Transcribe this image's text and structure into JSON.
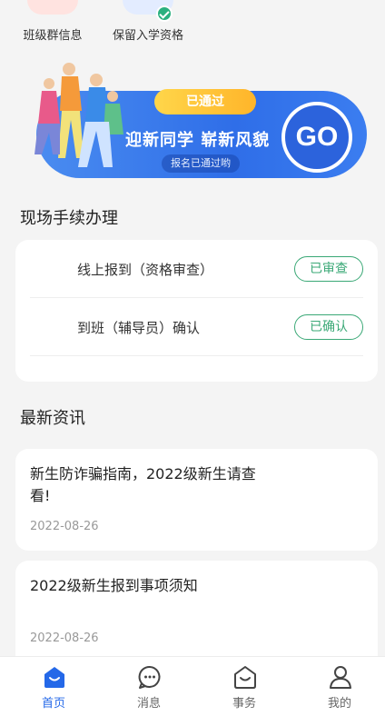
{
  "quick_actions": [
    {
      "label": "班级群信息"
    },
    {
      "label": "保留入学资格"
    }
  ],
  "banner": {
    "tag": "已通过",
    "slogan": "迎新同学 崭新风貌",
    "sub": "报名已通过哟",
    "go": "GO"
  },
  "procedures": {
    "title": "现场手续办理",
    "items": [
      {
        "label": "线上报到（资格审查）",
        "status": "已审查"
      },
      {
        "label": "到班（辅导员）确认",
        "status": "已确认"
      }
    ]
  },
  "news": {
    "title": "最新资讯",
    "items": [
      {
        "title": "新生防诈骗指南，2022级新生请查看!",
        "date": "2022-08-26"
      },
      {
        "title": "2022级新生报到事项须知",
        "date": "2022-08-26"
      }
    ]
  },
  "tabs": [
    {
      "label": "首页",
      "icon": "home-icon"
    },
    {
      "label": "消息",
      "icon": "message-icon"
    },
    {
      "label": "事务",
      "icon": "affairs-icon"
    },
    {
      "label": "我的",
      "icon": "profile-icon"
    }
  ],
  "colors": {
    "accent": "#2468e8",
    "success": "#3aa876",
    "banner_blue": "#2f6ee8",
    "banner_yellow": "#ffc83a"
  }
}
